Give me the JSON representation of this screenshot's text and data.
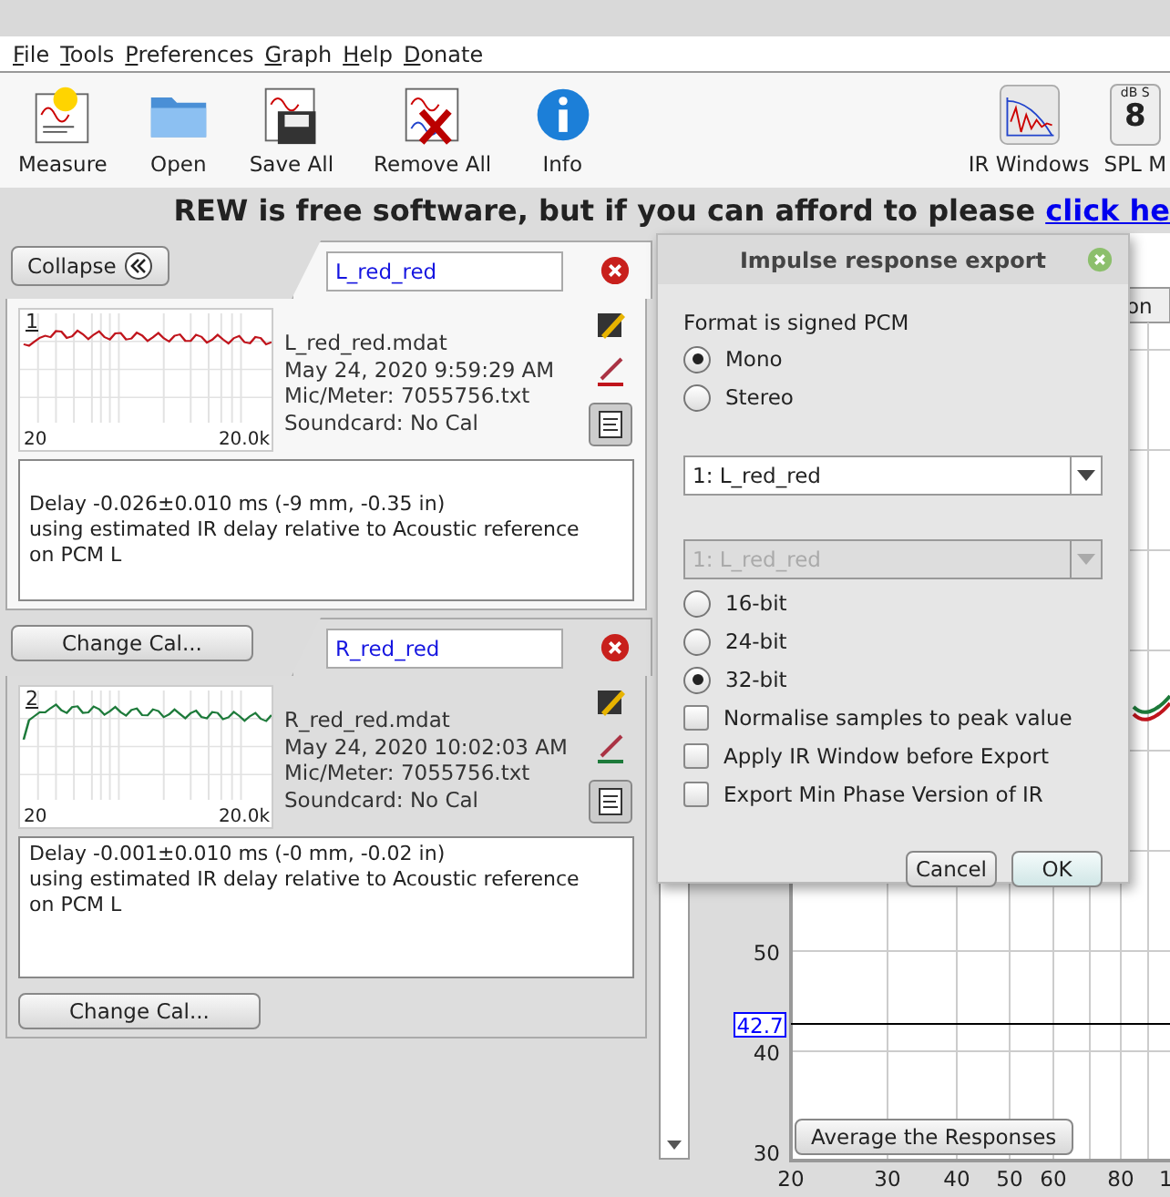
{
  "menu": [
    "File",
    "Tools",
    "Preferences",
    "Graph",
    "Help",
    "Donate"
  ],
  "toolbar": {
    "left": [
      {
        "kind": "measure",
        "label": "Measure"
      },
      {
        "kind": "open",
        "label": "Open"
      },
      {
        "kind": "save",
        "label": "Save All"
      },
      {
        "kind": "remove",
        "label": "Remove All"
      },
      {
        "kind": "info",
        "label": "Info"
      }
    ],
    "right": [
      {
        "kind": "ir",
        "label": "IR Windows"
      },
      {
        "kind": "spl",
        "label": "SPL M",
        "icon_top": "dB S",
        "icon_digit": "8"
      }
    ]
  },
  "banner": {
    "text": "REW is free software, but if you can afford to please ",
    "link": "click he"
  },
  "collapse_button": "Collapse",
  "measurements": [
    {
      "index": "1",
      "name": "L_red_red",
      "selected": true,
      "color": "#c0141c",
      "file": "L_red_red.mdat",
      "date": "May 24, 2020 9:59:29 AM",
      "mic": "Mic/Meter: 7055756.txt",
      "soundcard": "Soundcard: No Cal",
      "x_min": "20",
      "x_max": "20.0k",
      "notes": [
        "Delay -0.026±0.010 ms (-9 mm, -0.35 in)",
        "using estimated IR delay relative to Acoustic reference",
        "on PCM L"
      ],
      "button": "Change Cal..."
    },
    {
      "index": "2",
      "name": "R_red_red",
      "selected": false,
      "color": "#1d7a3a",
      "file": "R_red_red.mdat",
      "date": "May 24, 2020 10:02:03 AM",
      "mic": "Mic/Meter: 7055756.txt",
      "soundcard": "Soundcard: No Cal",
      "x_min": "20",
      "x_max": "20.0k",
      "notes": [
        "Delay -0.001±0.010 ms (-0 mm, -0.02 in)",
        "using estimated IR delay relative to Acoustic reference",
        "on PCM L"
      ],
      "button": "Change Cal..."
    }
  ],
  "graph": {
    "header_cell": "on",
    "y_ticks": [
      "50",
      "40",
      "30"
    ],
    "x_ticks": [
      "20",
      "30",
      "40",
      "50",
      "60",
      "80",
      "1"
    ],
    "cursor_value": "42.7",
    "average_button": "Average the Responses"
  },
  "dialog": {
    "title": "Impulse response export",
    "controls": [
      {
        "kind": "label",
        "label": "Format is signed PCM"
      },
      {
        "kind": "radio",
        "label": "Mono",
        "checked": true
      },
      {
        "kind": "radio",
        "label": "Stereo",
        "checked": false
      },
      {
        "kind": "gap"
      },
      {
        "kind": "select",
        "value": "1: L_red_red",
        "disabled": false
      },
      {
        "kind": "gap"
      },
      {
        "kind": "select",
        "value": "1: L_red_red",
        "disabled": true
      },
      {
        "kind": "radio",
        "label": "16-bit",
        "checked": false
      },
      {
        "kind": "radio",
        "label": "24-bit",
        "checked": false
      },
      {
        "kind": "radio",
        "label": "32-bit",
        "checked": true
      },
      {
        "kind": "checkbox",
        "label": "Normalise samples to peak value",
        "checked": false
      },
      {
        "kind": "checkbox",
        "label": "Apply IR Window before Export",
        "checked": false
      },
      {
        "kind": "checkbox",
        "label": "Export Min Phase Version of IR",
        "checked": false
      }
    ],
    "buttons": [
      {
        "kind": "cancel",
        "label": "Cancel"
      },
      {
        "kind": "ok",
        "label": "OK"
      }
    ]
  }
}
